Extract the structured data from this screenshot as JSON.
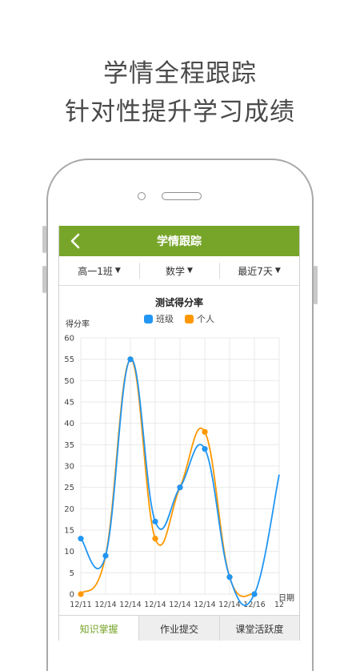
{
  "promo": {
    "line1": "学情全程跟踪",
    "line2": "针对性提升学习成绩"
  },
  "app": {
    "title": "学情跟踪",
    "back_icon": "chevron-left-icon",
    "accent_color": "#77a52a"
  },
  "filters": [
    {
      "label": "高一1班"
    },
    {
      "label": "数学"
    },
    {
      "label": "最近7天"
    }
  ],
  "tabs": [
    {
      "label": "知识掌握",
      "active": true
    },
    {
      "label": "作业提交",
      "active": false
    },
    {
      "label": "课堂活跃度",
      "active": false
    }
  ],
  "chart_data": {
    "type": "line",
    "title": "测试得分率",
    "ylabel": "得分率",
    "xlabel": "日期",
    "ylim": [
      0,
      60
    ],
    "yticks": [
      0,
      5,
      10,
      15,
      20,
      25,
      30,
      35,
      40,
      45,
      50,
      55,
      60
    ],
    "categories": [
      "12/11",
      "12/14",
      "12/14",
      "12/14",
      "12/14",
      "12/14",
      "12/14",
      "12/16",
      "12"
    ],
    "grid": true,
    "legend": "top-center",
    "series": [
      {
        "name": "班级",
        "color": "#2196f3",
        "values": [
          13,
          9,
          55,
          17,
          25,
          34,
          4,
          0,
          28
        ]
      },
      {
        "name": "个人",
        "color": "#ff9800",
        "values": [
          0,
          9,
          55,
          13,
          25,
          38,
          4,
          0,
          null
        ]
      }
    ]
  }
}
